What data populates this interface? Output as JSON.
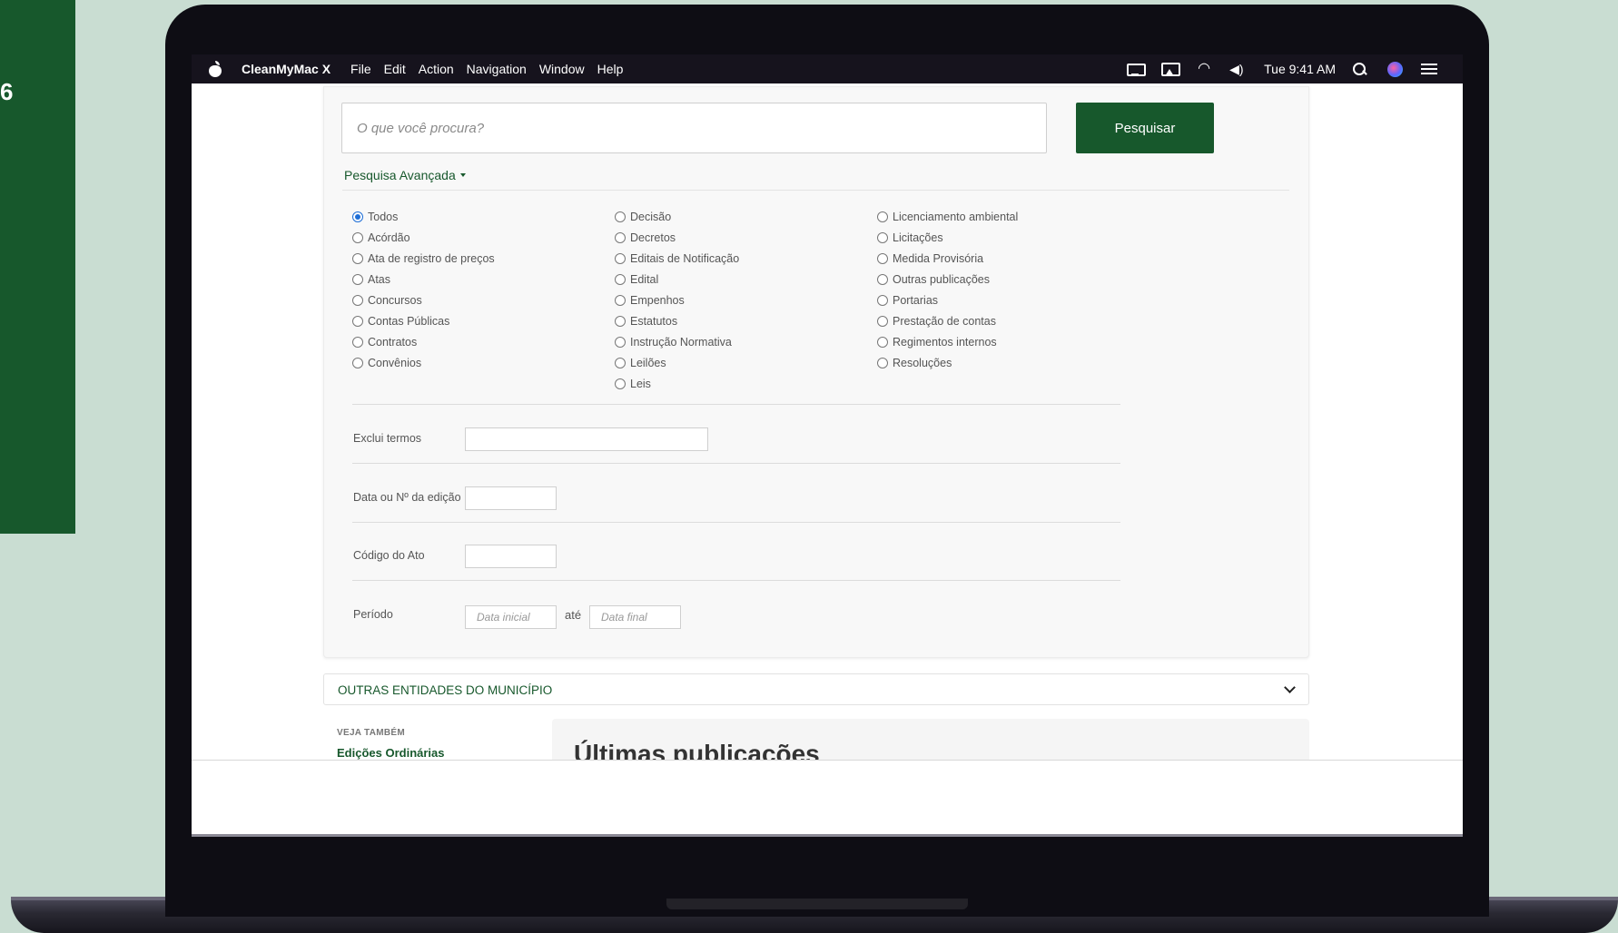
{
  "background": {
    "page_color": "#c9ddd2",
    "panel_color": "#17582c",
    "panel_glyph": "6"
  },
  "menubar": {
    "app_name": "CleanMyMac X",
    "menus": [
      "File",
      "Edit",
      "Action",
      "Navigation",
      "Window",
      "Help"
    ],
    "time": "Tue 9:41 AM",
    "status_icons": [
      "monitor-icon",
      "airplay-icon",
      "wifi-icon",
      "volume-icon",
      "spotlight-search-icon",
      "siri-icon",
      "control-center-icon"
    ]
  },
  "search": {
    "placeholder": "O que você procura?",
    "value": "",
    "button_label": "Pesquisar",
    "advanced_label": "Pesquisa Avançada"
  },
  "categories": {
    "selected": "Todos",
    "col1": [
      "Todos",
      "Acórdão",
      "Ata de registro de preços",
      "Atas",
      "Concursos",
      "Contas Públicas",
      "Contratos",
      "Convênios"
    ],
    "col2": [
      "Decisão",
      "Decretos",
      "Editais de Notificação",
      "Edital",
      "Empenhos",
      "Estatutos",
      "Instrução Normativa",
      "Leilões",
      "Leis"
    ],
    "col3": [
      "Licenciamento ambiental",
      "Licitações",
      "Medida Provisória",
      "Outras publicações",
      "Portarias",
      "Prestação de contas",
      "Regimentos internos",
      "Resoluções"
    ]
  },
  "form": {
    "exclude_label": "Exclui termos",
    "edition_label": "Data ou Nº da edição",
    "code_label": "Código do Ato",
    "period_label": "Período",
    "start_placeholder": "Data inicial",
    "until_label": "até",
    "end_placeholder": "Data final"
  },
  "entities": {
    "title": "OUTRAS ENTIDADES DO MUNICÍPIO"
  },
  "see_also": {
    "title": "VEJA TAMBÉM",
    "link": "Edições Ordinárias"
  },
  "latest": {
    "title": "Últimas publicações"
  },
  "colors": {
    "accent": "#17582c",
    "radio_selected": "#1e6ed6",
    "menubar": "#16131d"
  }
}
